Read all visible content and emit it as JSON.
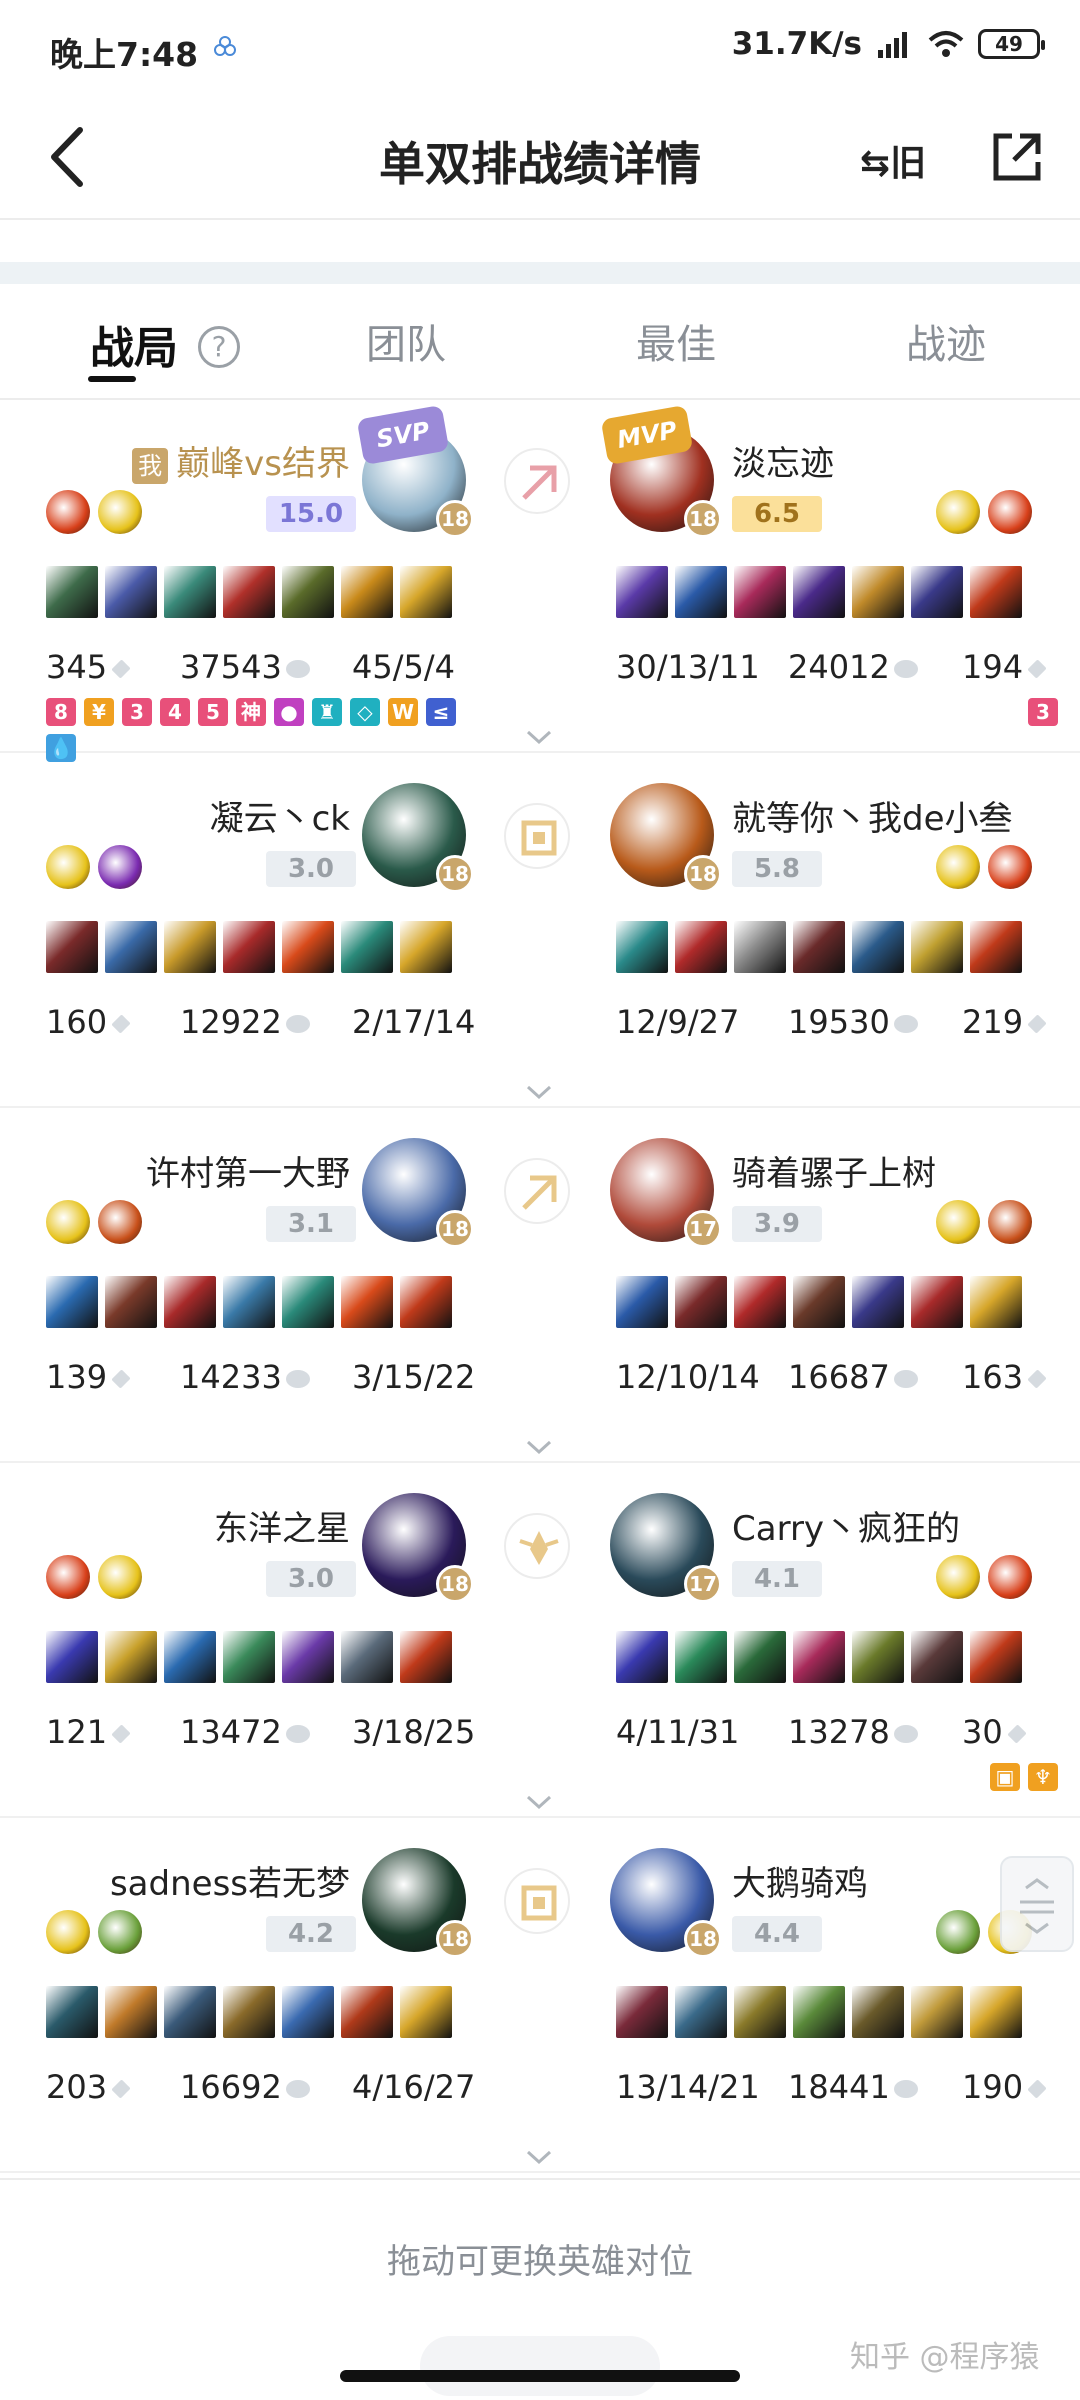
{
  "status_bar": {
    "time": "晚上7:48",
    "net_speed": "31.7K/s",
    "battery": "49"
  },
  "header": {
    "title": "单双排战绩详情",
    "switch_label": "⇆旧"
  },
  "tabs": [
    {
      "label": "战局",
      "active": true
    },
    {
      "label": "团队",
      "active": false
    },
    {
      "label": "最佳",
      "active": false
    },
    {
      "label": "战迹",
      "active": false
    }
  ],
  "help_symbol": "?",
  "matchups": [
    {
      "left": {
        "name": "巅峰vs结界",
        "me_tag": "我",
        "badge": "SVP",
        "score": "15.0",
        "level": "18",
        "stats": {
          "cs": "345",
          "gold": "37543",
          "kda": "45/5/4"
        },
        "avatar_color": "#8fb2c9",
        "spells": [
          "#d8401a",
          "#e6c21a"
        ],
        "items": [
          "#3e6b4a",
          "#4a5aa8",
          "#3a8a7a",
          "#b0302a",
          "#5a6b2a",
          "#c98a1a",
          "#d6a62a"
        ],
        "honor_badges": [
          {
            "text": "8",
            "color": "#e8507a"
          },
          {
            "text": "¥",
            "color": "#f0a020"
          },
          {
            "text": "3",
            "color": "#e8507a"
          },
          {
            "text": "4",
            "color": "#e8507a"
          },
          {
            "text": "5",
            "color": "#e8507a"
          },
          {
            "text": "神",
            "color": "#e8507a"
          },
          {
            "text": "●",
            "color": "#c040c0"
          },
          {
            "text": "♜",
            "color": "#20b0c0"
          },
          {
            "text": "◇",
            "color": "#20b0c0"
          },
          {
            "text": "W",
            "color": "#f0a020"
          },
          {
            "text": "≤",
            "color": "#4060d0"
          },
          {
            "text": "💧",
            "color": "#40a0e0"
          }
        ]
      },
      "right": {
        "name": "淡忘迹",
        "badge": "MVP",
        "score": "6.5",
        "level": "18",
        "stats": {
          "kda": "30/13/11",
          "gold": "24012",
          "cs": "194"
        },
        "avatar_color": "#a03020",
        "spells": [
          "#e6c21a",
          "#d8401a"
        ],
        "items": [
          "#5a3aa8",
          "#2a5aa8",
          "#a82a5a",
          "#4a2a8a",
          "#c08a2a",
          "#3a3a8a",
          "#c03a1a"
        ],
        "honor_badges": [
          {
            "text": "3",
            "color": "#e8507a"
          }
        ]
      },
      "role_icon": "jungle-icon",
      "role_color": "#e8a0a8"
    },
    {
      "left": {
        "name": "凝云丶ck",
        "score": "3.0",
        "level": "18",
        "stats": {
          "cs": "160",
          "gold": "12922",
          "kda": "2/17/14"
        },
        "avatar_color": "#2a5a4a",
        "spells": [
          "#e6c21a",
          "#7a2ab0"
        ],
        "items": [
          "#7a2a2a",
          "#3a6aa8",
          "#c89a2a",
          "#a82a2a",
          "#d84a1a",
          "#2a8a7a",
          "#d6a62a"
        ]
      },
      "right": {
        "name": "就等你丶我de小叁",
        "score": "5.8",
        "level": "18",
        "stats": {
          "kda": "12/9/27",
          "gold": "19530",
          "cs": "219"
        },
        "avatar_color": "#b85a1a",
        "spells": [
          "#e6c21a",
          "#d8401a"
        ],
        "items": [
          "#2a8a8a",
          "#b02a2a",
          "#8a8a8a",
          "#6a2a2a",
          "#2a5a8a",
          "#c0a030",
          "#c03a1a"
        ]
      },
      "role_icon": "mid-lane-icon",
      "role_color": "#e8c88a"
    },
    {
      "left": {
        "name": "许村第一大野",
        "score": "3.1",
        "level": "18",
        "stats": {
          "cs": "139",
          "gold": "14233",
          "kda": "3/15/22"
        },
        "avatar_color": "#4a6aa8",
        "spells": [
          "#e6c21a",
          "#c8501a"
        ],
        "items": [
          "#2a6ab0",
          "#7a3a2a",
          "#a82a2a",
          "#3a7aa8",
          "#2a8a7a",
          "#d84a1a",
          "#c03a1a"
        ]
      },
      "right": {
        "name": "骑着骡子上树",
        "score": "3.9",
        "level": "17",
        "stats": {
          "kda": "12/10/14",
          "gold": "16687",
          "cs": "163"
        },
        "avatar_color": "#b04a3a",
        "spells": [
          "#e6c21a",
          "#c8501a"
        ],
        "items": [
          "#2a5aa8",
          "#7a2a2a",
          "#b02a2a",
          "#6a3a2a",
          "#3a3a8a",
          "#a82a2a",
          "#d6a62a"
        ]
      },
      "role_icon": "jungle-icon",
      "role_color": "#e8c88a"
    },
    {
      "left": {
        "name": "东洋之星",
        "score": "3.0",
        "level": "18",
        "stats": {
          "cs": "121",
          "gold": "13472",
          "kda": "3/18/25"
        },
        "avatar_color": "#2a1a5a",
        "spells": [
          "#d8401a",
          "#e6c21a"
        ],
        "items": [
          "#3a3ab0",
          "#c8a02a",
          "#2a6ab0",
          "#3a8a5a",
          "#6a3aa8",
          "#5a6a7a",
          "#c03a1a"
        ]
      },
      "right": {
        "name": "Carry丶疯狂的",
        "score": "4.1",
        "level": "17",
        "stats": {
          "kda": "4/11/31",
          "gold": "13278",
          "cs": "30"
        },
        "avatar_color": "#2a4a5a",
        "spells": [
          "#e6c21a",
          "#d8401a"
        ],
        "items": [
          "#3a3ab0",
          "#2a8a5a",
          "#2a6a3a",
          "#a82a5a",
          "#6a7a2a",
          "#5a3a3a",
          "#c03a1a"
        ],
        "honor_badges": [
          {
            "text": "▣",
            "color": "#f0a020"
          },
          {
            "text": "♆",
            "color": "#f0a020"
          }
        ]
      },
      "role_icon": "support-icon",
      "role_color": "#e8c88a"
    },
    {
      "left": {
        "name": "sadness若无梦",
        "score": "4.2",
        "level": "18",
        "stats": {
          "cs": "203",
          "gold": "16692",
          "kda": "4/16/27"
        },
        "avatar_color": "#1a3a2a",
        "spells": [
          "#e6c21a",
          "#6aa03a"
        ],
        "items": [
          "#2a5a6a",
          "#c07a2a",
          "#3a5a7a",
          "#8a6a2a",
          "#3a6ab0",
          "#b03a1a",
          "#d6a62a"
        ]
      },
      "right": {
        "name": "大鹅骑鸡",
        "score": "4.4",
        "level": "18",
        "stats": {
          "kda": "13/14/21",
          "gold": "18441",
          "cs": "190"
        },
        "avatar_color": "#3a5aa8",
        "spells": [
          "#6aa03a",
          "#e6c21a"
        ],
        "items": [
          "#7a2a3a",
          "#3a6a8a",
          "#8a7a2a",
          "#5a8a3a",
          "#6a5a2a",
          "#c09a3a",
          "#d6a62a"
        ]
      },
      "role_icon": "mid-lane-icon",
      "role_color": "#e8c88a"
    }
  ],
  "footer": {
    "hint": "拖动可更换英雄对位",
    "watermark": "知乎 @程序猿"
  }
}
